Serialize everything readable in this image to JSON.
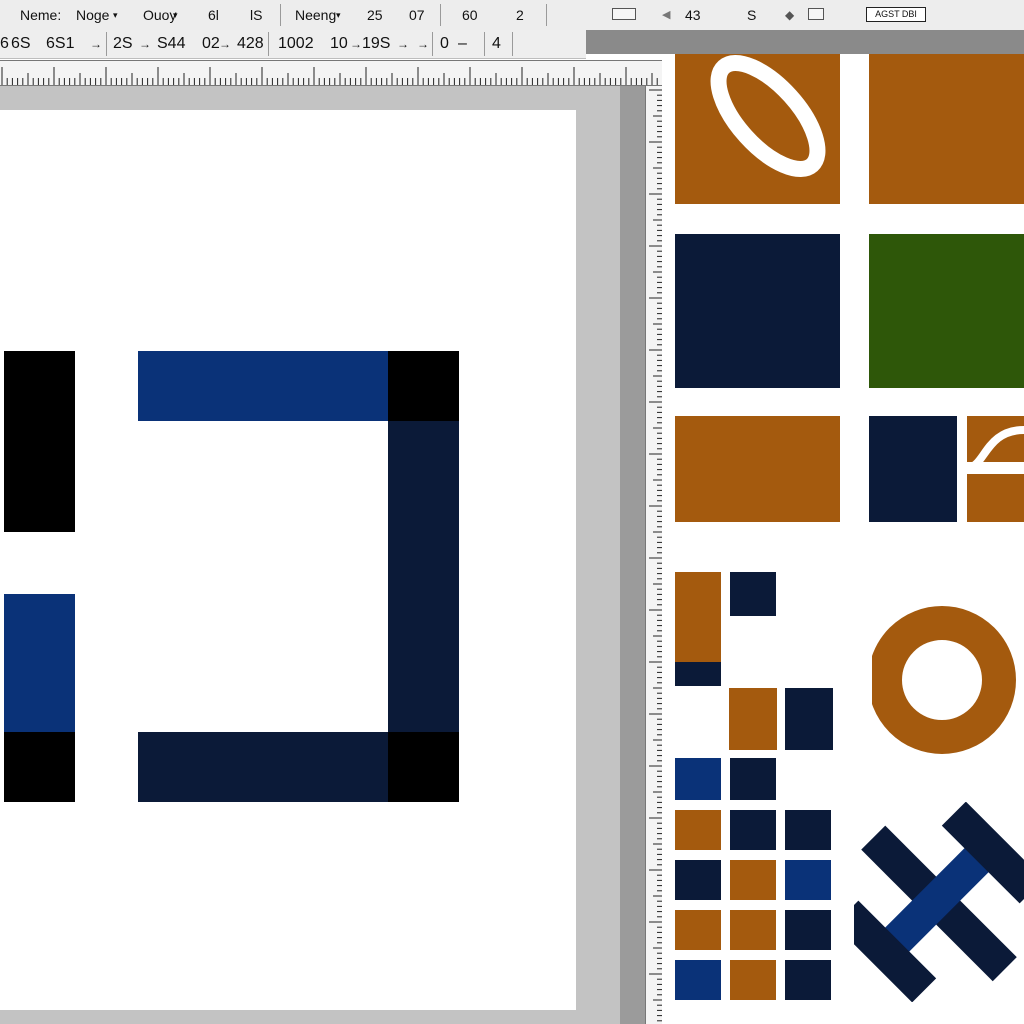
{
  "menubar": {
    "items": [
      "Neme:",
      "Noge",
      "Ouoy",
      "6l",
      "lS",
      "Neeng",
      "25",
      "07",
      "60",
      "2"
    ],
    "right_value": "43",
    "right_letter": "S",
    "tool_button_label": "AGST DBI"
  },
  "options_bar": {
    "items": [
      "6",
      "6S",
      "6S1",
      "2S",
      "S44",
      "02",
      "428",
      "1002",
      "10",
      "19S",
      "0",
      "4"
    ]
  },
  "colors": {
    "navy": "#0b1a38",
    "blue": "#0a3278",
    "black": "#000000",
    "orange": "#a45a0e",
    "green": "#2e5709",
    "artboard": "#ffffff",
    "pasteboard": "#c3c3c3"
  },
  "icons": [
    "chevron-down-icon",
    "arrow-right-icon",
    "frame-icon",
    "triangle-left-icon",
    "diamond-icon",
    "grid-icon"
  ]
}
